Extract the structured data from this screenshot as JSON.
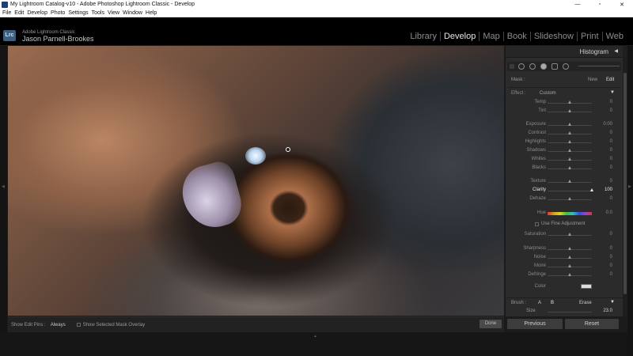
{
  "window": {
    "title": "My Lightroom Catalog-v10 - Adobe Photoshop Lightroom Classic - Develop",
    "minimize": "—",
    "maximize": "▫",
    "close": "✕"
  },
  "menu": [
    "File",
    "Edit",
    "Develop",
    "Photo",
    "Settings",
    "Tools",
    "View",
    "Window",
    "Help"
  ],
  "identity": {
    "logo": "Lrc",
    "product": "Adobe Lightroom Classic",
    "user": "Jason Parnell-Brookes"
  },
  "modules": [
    "Library",
    "Develop",
    "Map",
    "Book",
    "Slideshow",
    "Print",
    "Web"
  ],
  "active_module": "Develop",
  "panel": {
    "title": "Histogram",
    "collapse": "◀",
    "mask_label": "Mask :",
    "new_label": "New",
    "edit_label": "Edit",
    "effect_label": "Effect :",
    "effect_value": "Custom",
    "effect_arrow": "▼"
  },
  "sliders": {
    "temp": {
      "name": "Temp",
      "value": "0",
      "pos": 0.5
    },
    "tint": {
      "name": "Tint",
      "value": "0",
      "pos": 0.5
    },
    "exposure": {
      "name": "Exposure",
      "value": "0.00",
      "pos": 0.5
    },
    "contrast": {
      "name": "Contrast",
      "value": "0",
      "pos": 0.5
    },
    "highlights": {
      "name": "Highlights",
      "value": "0",
      "pos": 0.5
    },
    "shadows": {
      "name": "Shadows",
      "value": "0",
      "pos": 0.5
    },
    "whites": {
      "name": "Whites",
      "value": "0",
      "pos": 0.5
    },
    "blacks": {
      "name": "Blacks",
      "value": "0",
      "pos": 0.5
    },
    "texture": {
      "name": "Texture",
      "value": "0",
      "pos": 0.5
    },
    "clarity": {
      "name": "Clarity",
      "value": "100",
      "pos": 1.0
    },
    "dehaze": {
      "name": "Dehaze",
      "value": "0",
      "pos": 0.5
    },
    "saturation": {
      "name": "Saturation",
      "value": "0",
      "pos": 0.5
    },
    "sharpness": {
      "name": "Sharpness",
      "value": "0",
      "pos": 0.5
    },
    "noise": {
      "name": "Noise",
      "value": "0",
      "pos": 0.5
    },
    "moire": {
      "name": "Moiré",
      "value": "0",
      "pos": 0.5
    },
    "defringe": {
      "name": "Defringe",
      "value": "0",
      "pos": 0.5
    }
  },
  "hue": {
    "name": "Hue",
    "value": "0.0"
  },
  "fine_adjust": "Use Fine Adjustment",
  "color_label": "Color",
  "brush": {
    "label": "Brush :",
    "a": "A",
    "b": "B",
    "erase": "Erase",
    "arrow": "▼",
    "size_label": "Size",
    "size_value": "23.0"
  },
  "toolbar": {
    "show_pins_label": "Show Edit Pins :",
    "show_pins_value": "Always",
    "overlay_label": "Show Selected Mask Overlay",
    "done": "Done"
  },
  "buttons": {
    "previous": "Previous",
    "reset": "Reset"
  }
}
